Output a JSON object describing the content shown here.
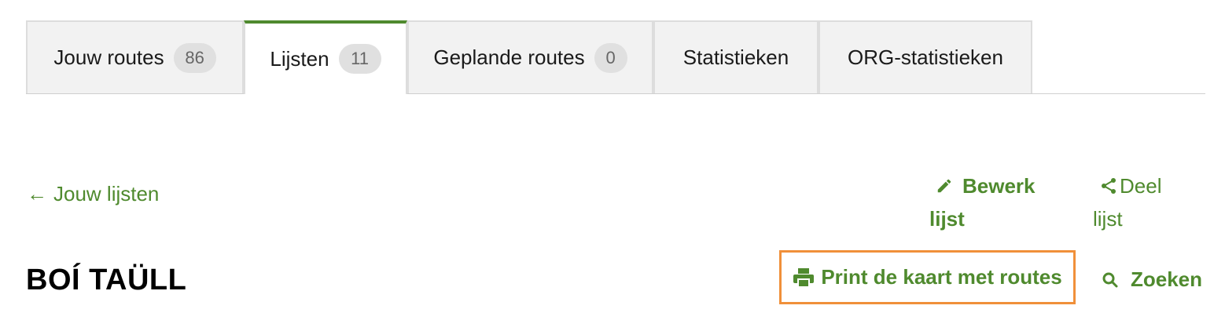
{
  "tabs": [
    {
      "label": "Jouw routes",
      "count": "86"
    },
    {
      "label": "Lijsten",
      "count": "11"
    },
    {
      "label": "Geplande routes",
      "count": "0"
    },
    {
      "label": "Statistieken"
    },
    {
      "label": "ORG-statistieken"
    }
  ],
  "active_tab": "Lijsten",
  "back_link": "Jouw lijsten",
  "actions": {
    "edit_line1": "Bewerk",
    "edit_line2": "lijst",
    "share_line1": "Deel",
    "share_line2": "lijst",
    "print_label": "Print de kaart met routes",
    "search_label": "Zoeken"
  },
  "list_title": "BOÍ TAÜLL",
  "colors": {
    "accent": "#4f8a2e",
    "highlight_border": "#f0903a",
    "tab_bg": "#f2f2f2"
  },
  "icons": {
    "back": "arrow-left-icon",
    "edit": "pencil-icon",
    "share": "share-icon",
    "print": "printer-icon",
    "search": "search-icon"
  }
}
